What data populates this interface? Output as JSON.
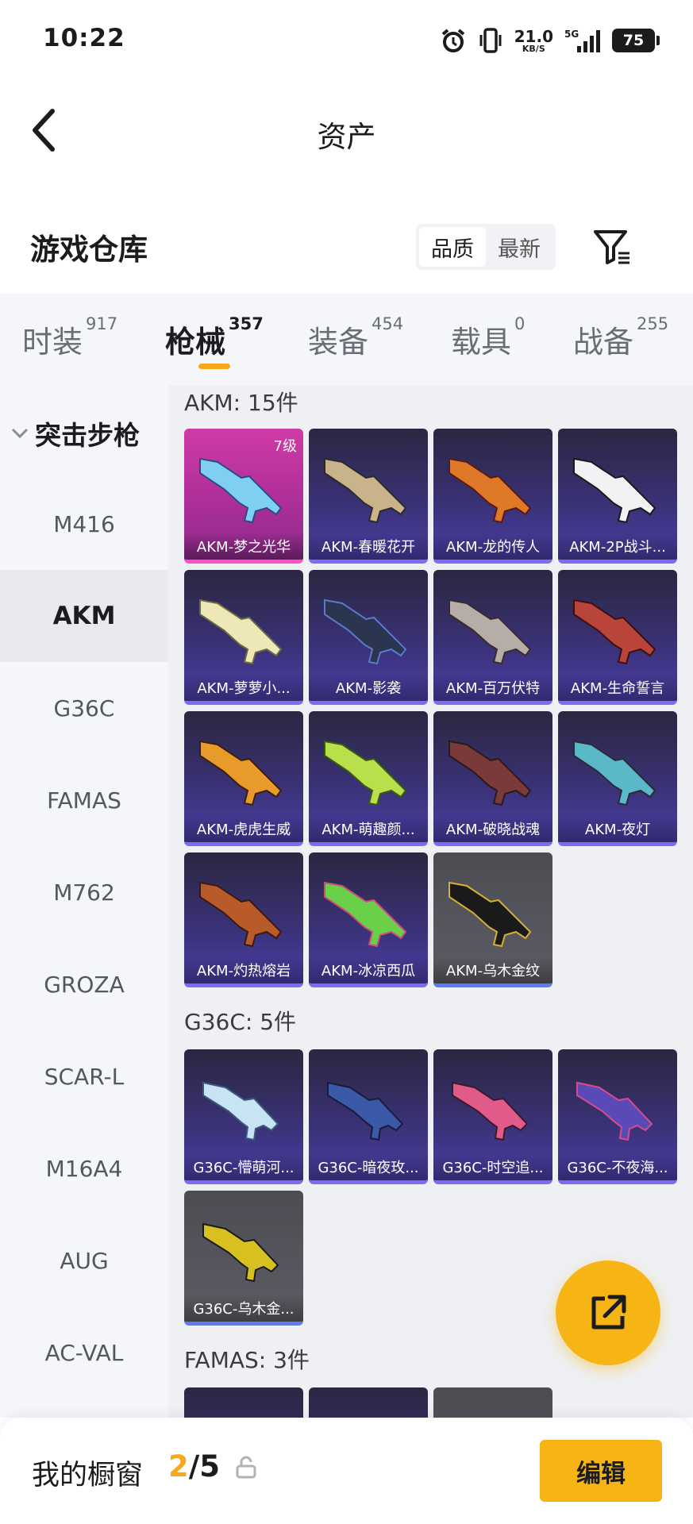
{
  "status_bar": {
    "time": "10:22",
    "net_speed": "21.0",
    "net_unit": "KB/S",
    "signal_label": "5G",
    "battery": "75"
  },
  "nav": {
    "title": "资产"
  },
  "header": {
    "title": "游戏仓库",
    "sort_options": [
      "品质",
      "最新"
    ],
    "sort_selected": "品质"
  },
  "tabs": [
    {
      "label": "时装",
      "count": "917"
    },
    {
      "label": "枪械",
      "count": "357"
    },
    {
      "label": "装备",
      "count": "454"
    },
    {
      "label": "载具",
      "count": "0"
    },
    {
      "label": "战备",
      "count": "255"
    }
  ],
  "sidebar": {
    "category": "突击步枪",
    "items": [
      "M416",
      "AKM",
      "G36C",
      "FAMAS",
      "M762",
      "GROZA",
      "SCAR-L",
      "M16A4",
      "AUG",
      "AC-VAL"
    ],
    "selected": "AKM"
  },
  "sections": [
    {
      "title": "AKM: 15件",
      "items": [
        {
          "name": "AKM-梦之光华",
          "level": "7级"
        },
        {
          "name": "AKM-春暖花开"
        },
        {
          "name": "AKM-龙的传人"
        },
        {
          "name": "AKM-2P战斗..."
        },
        {
          "name": "AKM-萝萝小..."
        },
        {
          "name": "AKM-影袭"
        },
        {
          "name": "AKM-百万伏特"
        },
        {
          "name": "AKM-生命誓言"
        },
        {
          "name": "AKM-虎虎生威"
        },
        {
          "name": "AKM-萌趣颜..."
        },
        {
          "name": "AKM-破晓战魂"
        },
        {
          "name": "AKM-夜灯"
        },
        {
          "name": "AKM-灼热熔岩"
        },
        {
          "name": "AKM-冰凉西瓜"
        },
        {
          "name": "AKM-乌木金纹"
        }
      ]
    },
    {
      "title": "G36C: 5件",
      "items": [
        {
          "name": "G36C-懵萌河..."
        },
        {
          "name": "G36C-暗夜玫..."
        },
        {
          "name": "G36C-时空追..."
        },
        {
          "name": "G36C-不夜海..."
        },
        {
          "name": "G36C-乌木金..."
        }
      ]
    },
    {
      "title": "FAMAS: 3件",
      "items": []
    }
  ],
  "bottom_bar": {
    "title": "我的橱窗",
    "current": "2",
    "total": "/5",
    "edit_label": "编辑"
  },
  "colors": {
    "accent": "#f7b515",
    "card_purple": "#3b3279",
    "card_pink": "#cf3aa6",
    "card_gray": "#55565c"
  }
}
